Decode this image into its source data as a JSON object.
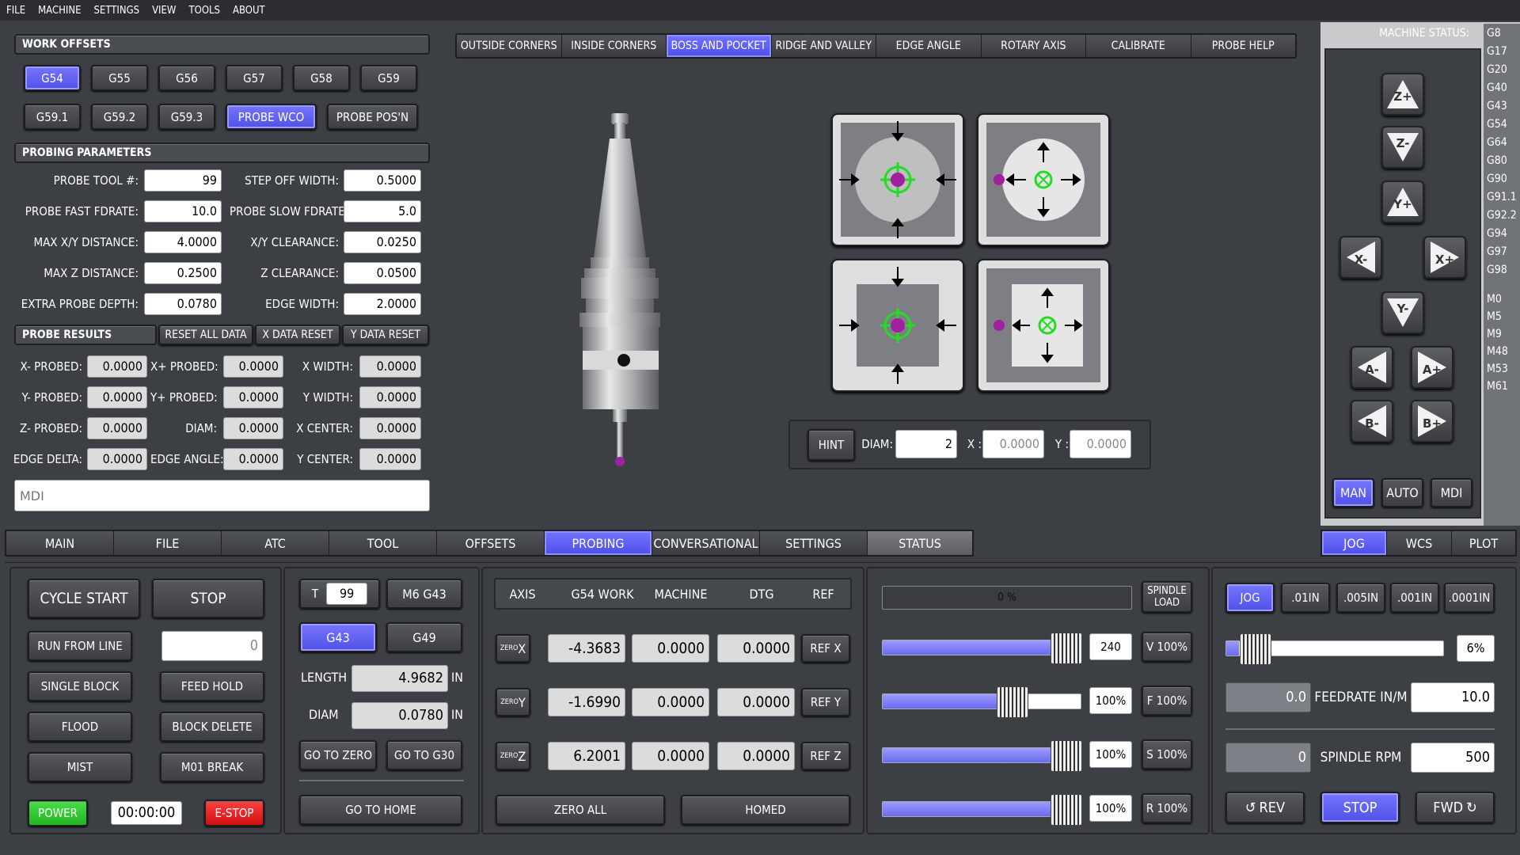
{
  "menu": [
    "FILE",
    "MACHINE",
    "SETTINGS",
    "VIEW",
    "TOOLS",
    "ABOUT"
  ],
  "work_offsets": {
    "header": "WORK OFFSETS",
    "row1": [
      "G54",
      "G55",
      "G56",
      "G57",
      "G58",
      "G59"
    ],
    "row2": [
      "G59.1",
      "G59.2",
      "G59.3",
      "PROBE WCO",
      "PROBE POS'N"
    ],
    "selected": [
      "G54",
      "PROBE WCO"
    ]
  },
  "probing_params": {
    "header": "PROBING PARAMETERS",
    "left": [
      {
        "label": "PROBE TOOL #:",
        "value": "99"
      },
      {
        "label": "PROBE FAST FDRATE:",
        "value": "10.0"
      },
      {
        "label": "MAX X/Y DISTANCE:",
        "value": "4.0000"
      },
      {
        "label": "MAX Z DISTANCE:",
        "value": "0.2500"
      },
      {
        "label": "EXTRA PROBE DEPTH:",
        "value": "0.0780"
      }
    ],
    "right": [
      {
        "label": "STEP OFF WIDTH:",
        "value": "0.5000"
      },
      {
        "label": "PROBE SLOW FDRATE:",
        "value": "5.0"
      },
      {
        "label": "X/Y CLEARANCE:",
        "value": "0.0250"
      },
      {
        "label": "Z CLEARANCE:",
        "value": "0.0500"
      },
      {
        "label": "EDGE WIDTH:",
        "value": "2.0000"
      }
    ]
  },
  "probe_results": {
    "header": "PROBE RESULTS",
    "buttons": [
      "RESET ALL DATA",
      "X DATA RESET",
      "Y DATA RESET"
    ],
    "col1": [
      {
        "label": "X- PROBED:",
        "value": "0.0000"
      },
      {
        "label": "Y- PROBED:",
        "value": "0.0000"
      },
      {
        "label": "Z- PROBED:",
        "value": "0.0000"
      },
      {
        "label": "EDGE DELTA:",
        "value": "0.0000"
      }
    ],
    "col2": [
      {
        "label": "X+ PROBED:",
        "value": "0.0000"
      },
      {
        "label": "Y+ PROBED:",
        "value": "0.0000"
      },
      {
        "label": "DIAM:",
        "value": "0.0000"
      },
      {
        "label": "EDGE ANGLE:",
        "value": "0.0000"
      }
    ],
    "col3": [
      {
        "label": "X WIDTH:",
        "value": "0.0000"
      },
      {
        "label": "Y WIDTH:",
        "value": "0.0000"
      },
      {
        "label": "X CENTER:",
        "value": "0.0000"
      },
      {
        "label": "Y CENTER:",
        "value": "0.0000"
      }
    ]
  },
  "mdi": {
    "placeholder": "MDI"
  },
  "probe_tabs": [
    "OUTSIDE CORNERS",
    "INSIDE CORNERS",
    "BOSS AND POCKET",
    "RIDGE AND VALLEY",
    "EDGE ANGLE",
    "ROTARY AXIS",
    "CALIBRATE",
    "PROBE HELP"
  ],
  "probe_tab_selected": "BOSS AND POCKET",
  "hint": {
    "button": "HINT",
    "diam_label": "DIAM:",
    "diam_value": "2",
    "x_label": "X :",
    "x_value": "0.0000",
    "y_label": "Y :",
    "y_value": "0.0000"
  },
  "machine_status": {
    "title": "MACHINE STATUS:",
    "gcodes": [
      "G8",
      "G17",
      "G20",
      "G40",
      "G43",
      "G54",
      "G64",
      "G80",
      "G90",
      "G91.1",
      "G92.2",
      "G94",
      "G97",
      "G98"
    ],
    "mcodes": [
      "M0",
      "M5",
      "M9",
      "M48",
      "M53",
      "M61"
    ]
  },
  "jog_buttons": [
    "Z+",
    "Z-",
    "Y+",
    "X-",
    "X+",
    "Y-",
    "A-",
    "A+",
    "B-",
    "B+"
  ],
  "mode_buttons": [
    "MAN",
    "AUTO",
    "MDI"
  ],
  "mode_selected": "MAN",
  "main_tabs": [
    "MAIN",
    "FILE",
    "ATC",
    "TOOL",
    "OFFSETS",
    "PROBING",
    "CONVERSATIONAL",
    "SETTINGS",
    "STATUS"
  ],
  "main_tab_selected": "PROBING",
  "right_tabs": [
    "JOG",
    "WCS",
    "PLOT"
  ],
  "right_tab_selected": "JOG",
  "control": {
    "cycle_start": "CYCLE START",
    "stop": "STOP",
    "run_from_line": "RUN FROM LINE",
    "run_from_value": "0",
    "single_block": "SINGLE BLOCK",
    "feed_hold": "FEED HOLD",
    "flood": "FLOOD",
    "block_delete": "BLOCK DELETE",
    "mist": "MIST",
    "m01_break": "M01 BREAK",
    "power": "POWER",
    "timer": "00:00:00",
    "estop": "E-STOP"
  },
  "tool": {
    "t_label": "T",
    "t_value": "99",
    "m6g43": "M6 G43",
    "g43": "G43",
    "g49": "G49",
    "length_label": "LENGTH",
    "length_value": "4.9682",
    "length_unit": "IN",
    "diam_label": "DIAM",
    "diam_value": "0.0780",
    "diam_unit": "IN",
    "go_zero": "GO TO ZERO",
    "go_g30": "GO TO G30",
    "go_home": "GO TO HOME"
  },
  "dro": {
    "headers": [
      "AXIS",
      "G54 WORK",
      "MACHINE",
      "DTG",
      "REF"
    ],
    "rows": [
      {
        "zero": "ZERO",
        "axis": "X",
        "work": "-4.3683",
        "machine": "0.0000",
        "dtg": "0.0000",
        "ref": "REF X"
      },
      {
        "zero": "ZERO",
        "axis": "Y",
        "work": "-1.6990",
        "machine": "0.0000",
        "dtg": "0.0000",
        "ref": "REF Y"
      },
      {
        "zero": "ZERO",
        "axis": "Z",
        "work": "6.2001",
        "machine": "0.0000",
        "dtg": "0.0000",
        "ref": "REF Z"
      }
    ],
    "zero_all": "ZERO ALL",
    "homed": "HOMED"
  },
  "overrides": {
    "spindle_load_pct": 0,
    "spindle_load_text": "0 %",
    "spindle_load_label": "SPINDLE LOAD",
    "rows": [
      {
        "value": "240",
        "button": "V 100%",
        "level": 0.85
      },
      {
        "value": "100%",
        "button": "F 100%",
        "level": 0.58
      },
      {
        "value": "100%",
        "button": "S 100%",
        "level": 0.85
      },
      {
        "value": "100%",
        "button": "R 100%",
        "level": 0.85
      }
    ]
  },
  "jog_panel": {
    "increments": [
      "JOG",
      ".01IN",
      ".005IN",
      ".001IN",
      ".0001IN"
    ],
    "selected": "JOG",
    "jog_pct": "6%",
    "jog_level": 0.06,
    "feed_actual": "0.0",
    "feed_label": "FEEDRATE IN/M",
    "feed_value": "10.0",
    "rpm_actual": "0",
    "rpm_label": "SPINDLE RPM",
    "rpm_value": "500",
    "rev": "REV",
    "stop": "STOP",
    "fwd": "FWD"
  },
  "colors": {
    "accent": "#5a5af0",
    "green": "#2ecc2e",
    "red": "#e02020",
    "probe_ring": "#22dd22",
    "probe_ball": "#a020a0"
  }
}
